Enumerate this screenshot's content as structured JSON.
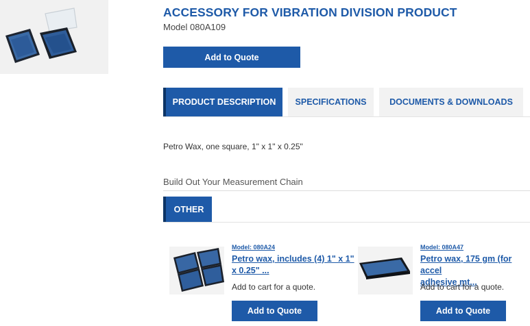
{
  "product": {
    "title": "ACCESSORY FOR VIBRATION DIVISION PRODUCT",
    "model": "Model 080A109",
    "add_to_quote": "Add to Quote",
    "image_icon": "wax-boxes-photo"
  },
  "tabs": [
    {
      "label": "PRODUCT DESCRIPTION",
      "active": true
    },
    {
      "label": "SPECIFICATIONS",
      "active": false
    },
    {
      "label": "DOCUMENTS & DOWNLOADS",
      "active": false
    }
  ],
  "description": "Petro Wax, one square, 1\" x 1\" x 0.25\"",
  "chain": {
    "heading": "Build Out Your Measurement Chain",
    "category_tab": "OTHER"
  },
  "related": [
    {
      "model": "Model: 080A24",
      "name_line1": "Petro wax, includes (4) 1\" x 1\"",
      "name_line2": "x 0.25\" ...",
      "note": "Add to cart for a quote.",
      "button": "Add to Quote",
      "image_icon": "four-wax-boxes-photo"
    },
    {
      "model": "Model: 080A47",
      "name_line1": "Petro wax, 175 gm (for accel",
      "name_line2": "adhesive mt...",
      "note": "Add to cart for a quote.",
      "button": "Add to Quote",
      "image_icon": "single-wax-box-photo"
    }
  ],
  "colors": {
    "brand_blue": "#1e5aa8",
    "tab_accent": "#0d3566",
    "tab_inactive_bg": "#f2f2f2"
  }
}
